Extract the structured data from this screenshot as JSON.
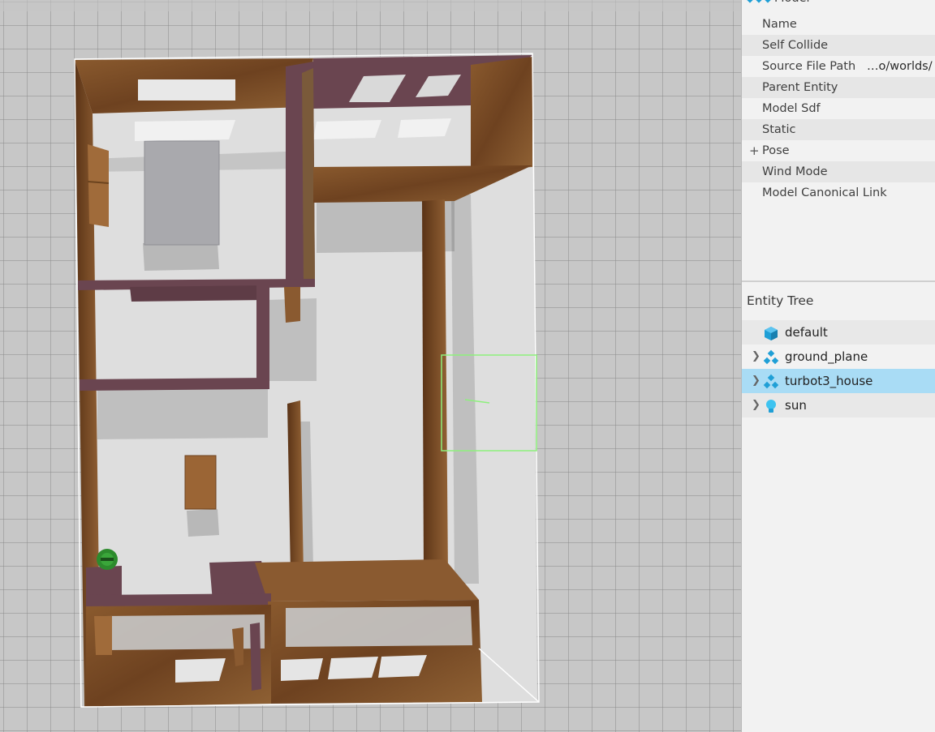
{
  "component_inspector": {
    "header_label": "Model",
    "header_icon": "model-icon",
    "rows": [
      {
        "label": "Name",
        "value": ""
      },
      {
        "label": "Self Collide",
        "value": ""
      },
      {
        "label": "Source File Path",
        "value": "…o/worlds/"
      },
      {
        "label": "Parent Entity",
        "value": ""
      },
      {
        "label": "Model Sdf",
        "value": ""
      },
      {
        "label": "Static",
        "value": ""
      },
      {
        "label": "Pose",
        "value": "",
        "expander": "+"
      },
      {
        "label": "Wind Mode",
        "value": ""
      },
      {
        "label": "Model Canonical Link",
        "value": ""
      }
    ]
  },
  "entity_tree": {
    "title": "Entity Tree",
    "items": [
      {
        "label": "default",
        "icon": "world-cube-icon",
        "expandable": false,
        "selected": false
      },
      {
        "label": "ground_plane",
        "icon": "model-icon",
        "expandable": true,
        "selected": false
      },
      {
        "label": "turbot3_house",
        "icon": "model-icon",
        "expandable": true,
        "selected": true
      },
      {
        "label": "sun",
        "icon": "light-bulb-icon",
        "expandable": true,
        "selected": false
      }
    ]
  },
  "colors": {
    "selection": "#a9dcf5",
    "grid_bg": "#c9c9c9",
    "floor": "#dcdcdc",
    "wood": "#7a4a22",
    "brick": "#6b4650",
    "bbox_highlight": "#8df07c",
    "robot": "#2f8f2f",
    "icon_blue": "#1f9fd6"
  }
}
